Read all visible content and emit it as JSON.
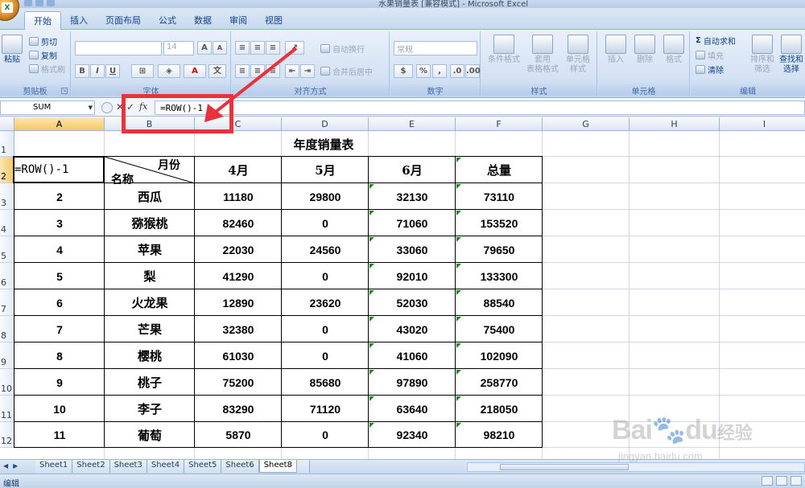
{
  "window": {
    "title": "水果销量表 [兼容模式] - Microsoft Excel"
  },
  "ribbon_tabs": [
    "开始",
    "插入",
    "页面布局",
    "公式",
    "数据",
    "审阅",
    "视图"
  ],
  "clipboard": {
    "paste": "粘贴",
    "cut": "剪切",
    "copy": "复制",
    "format_painter": "格式刷",
    "group": "剪贴板"
  },
  "font": {
    "size": "14",
    "bold": "B",
    "italic": "I",
    "underline": "U",
    "grow": "A",
    "shrink": "A",
    "color": "A",
    "group": "字体"
  },
  "alignment": {
    "wrap": "自动换行",
    "merge": "合并后居中",
    "group": "对齐方式"
  },
  "number": {
    "format": "常规",
    "percent": "%",
    "comma": ",",
    "group": "数字"
  },
  "styles": {
    "cond": "条件格式",
    "table": "套用\n表格格式",
    "cell": "单元格\n样式",
    "group": "样式"
  },
  "cells": {
    "insert": "插入",
    "delete": "删除",
    "format": "格式",
    "group": "单元格"
  },
  "editing": {
    "autosum": "自动求和",
    "fill": "填充",
    "clear": "清除",
    "sort": "排序和\n筛选",
    "find": "查找和\n选择",
    "group": "编辑"
  },
  "formula_bar": {
    "name_box": "SUM",
    "formula": "=ROW()-1"
  },
  "columns": [
    "A",
    "B",
    "C",
    "D",
    "E",
    "F",
    "G",
    "H",
    "I"
  ],
  "rows": [
    "1",
    "2",
    "3",
    "4",
    "5",
    "6",
    "7",
    "8",
    "9",
    "10",
    "11",
    "12"
  ],
  "table": {
    "title": "年度销量表",
    "header_month": "月份",
    "header_name": "名称",
    "edit_cell": "=ROW()-1",
    "months": [
      "4月",
      "5月",
      "6月",
      "总量"
    ],
    "rows": [
      {
        "no": "2",
        "name": "西瓜",
        "v": [
          "11180",
          "29800",
          "32130",
          "73110"
        ]
      },
      {
        "no": "3",
        "name": "猕猴桃",
        "v": [
          "82460",
          "0",
          "71060",
          "153520"
        ]
      },
      {
        "no": "4",
        "name": "苹果",
        "v": [
          "22030",
          "24560",
          "33060",
          "79650"
        ]
      },
      {
        "no": "5",
        "name": "梨",
        "v": [
          "41290",
          "0",
          "92010",
          "133300"
        ]
      },
      {
        "no": "6",
        "name": "火龙果",
        "v": [
          "12890",
          "23620",
          "52030",
          "88540"
        ]
      },
      {
        "no": "7",
        "name": "芒果",
        "v": [
          "32380",
          "0",
          "43020",
          "75400"
        ]
      },
      {
        "no": "8",
        "name": "樱桃",
        "v": [
          "61030",
          "0",
          "41060",
          "102090"
        ]
      },
      {
        "no": "9",
        "name": "桃子",
        "v": [
          "75200",
          "85680",
          "97890",
          "258770"
        ]
      },
      {
        "no": "10",
        "name": "李子",
        "v": [
          "83290",
          "71120",
          "63640",
          "218050"
        ]
      },
      {
        "no": "11",
        "name": "葡萄",
        "v": [
          "5870",
          "0",
          "92340",
          "98210"
        ]
      }
    ]
  },
  "sheets": [
    "Sheet1",
    "Sheet2",
    "Sheet3",
    "Sheet4",
    "Sheet5",
    "Sheet6",
    "Sheet8"
  ],
  "active_sheet": "Sheet8",
  "status": "编辑",
  "watermark": {
    "brand": "Bai",
    "brand2": "du",
    "cn": "经验",
    "url": "jingyan.baidu.com"
  },
  "colors": {
    "highlight": "#e8333c",
    "accent": "#15428b"
  }
}
